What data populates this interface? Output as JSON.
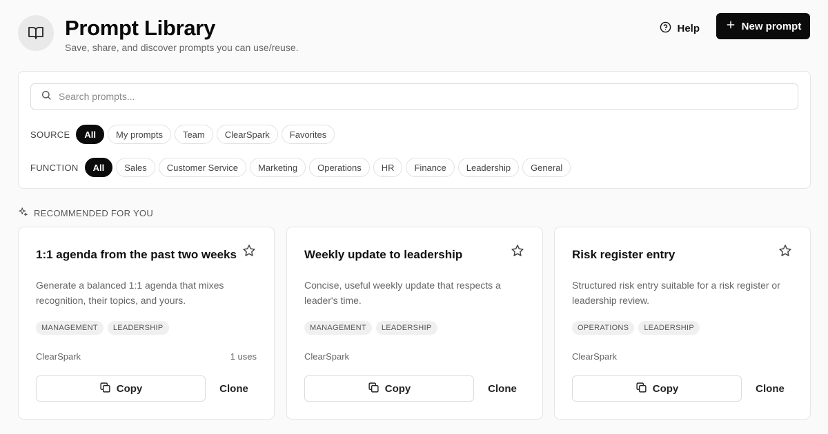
{
  "header": {
    "title": "Prompt Library",
    "subtitle": "Save, share, and discover prompts you can use/reuse.",
    "help_label": "Help",
    "new_prompt_label": "New prompt",
    "logo_icon": "book-open-icon"
  },
  "search": {
    "placeholder": "Search prompts...",
    "value": ""
  },
  "filters": {
    "source": {
      "label": "SOURCE",
      "options": [
        "All",
        "My prompts",
        "Team",
        "ClearSpark",
        "Favorites"
      ],
      "selected": "All"
    },
    "function": {
      "label": "FUNCTION",
      "options": [
        "All",
        "Sales",
        "Customer Service",
        "Marketing",
        "Operations",
        "HR",
        "Finance",
        "Leadership",
        "General"
      ],
      "selected": "All"
    }
  },
  "recommended": {
    "label": "RECOMMENDED FOR YOU",
    "icon": "sparkles-icon",
    "cards": [
      {
        "title": "1:1 agenda from the past two weeks",
        "description": "Generate a balanced 1:1 agenda that mixes recognition, their topics, and yours.",
        "tags": [
          "MANAGEMENT",
          "LEADERSHIP"
        ],
        "source": "ClearSpark",
        "uses": "1 uses",
        "copy_label": "Copy",
        "clone_label": "Clone"
      },
      {
        "title": "Weekly update to leadership",
        "description": "Concise, useful weekly update that respects a leader's time.",
        "tags": [
          "MANAGEMENT",
          "LEADERSHIP"
        ],
        "source": "ClearSpark",
        "uses": "",
        "copy_label": "Copy",
        "clone_label": "Clone"
      },
      {
        "title": "Risk register entry",
        "description": "Structured risk entry suitable for a risk register or leadership review.",
        "tags": [
          "OPERATIONS",
          "LEADERSHIP"
        ],
        "source": "ClearSpark",
        "uses": "",
        "copy_label": "Copy",
        "clone_label": "Clone"
      }
    ]
  },
  "colors": {
    "primary": "#0b0b0b",
    "background": "#fafafa",
    "border": "#e5e5e5",
    "muted_text": "#666666"
  }
}
